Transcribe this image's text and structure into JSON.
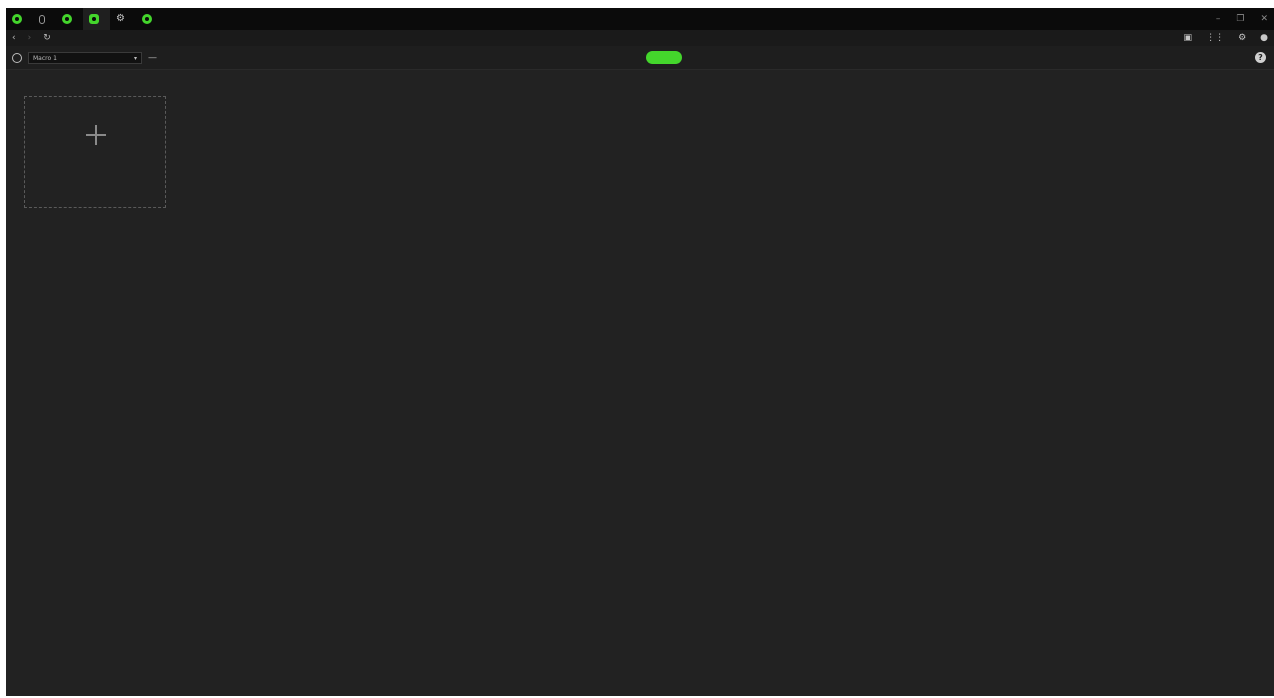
{
  "tabs": [
    {
      "label": "",
      "icon": "synapse-icon",
      "active": false
    },
    {
      "label": "",
      "icon": "mouse-icon",
      "active": false
    },
    {
      "label": "",
      "icon": "app-icon",
      "active": false
    },
    {
      "label": "",
      "icon": "macro-app-icon",
      "active": true
    },
    {
      "label": "",
      "icon": "gear-icon",
      "active": false
    },
    {
      "label": "",
      "icon": "app-icon",
      "active": false
    }
  ],
  "nav": {
    "back": "‹",
    "forward": "›",
    "refresh": "↻",
    "title": "",
    "right_icons": [
      "notification-icon",
      "apps-grid-icon",
      "settings-icon",
      "account-icon"
    ]
  },
  "profile": {
    "selected": "Macro 1",
    "arrow": "▾",
    "more": "—",
    "label": ""
  },
  "toggle": {
    "off_label": "",
    "on_label": ""
  },
  "add_card": {
    "label": ""
  },
  "colors": {
    "accent": "#44d62c",
    "background": "#222222",
    "titlebar": "#0b0b0b"
  }
}
